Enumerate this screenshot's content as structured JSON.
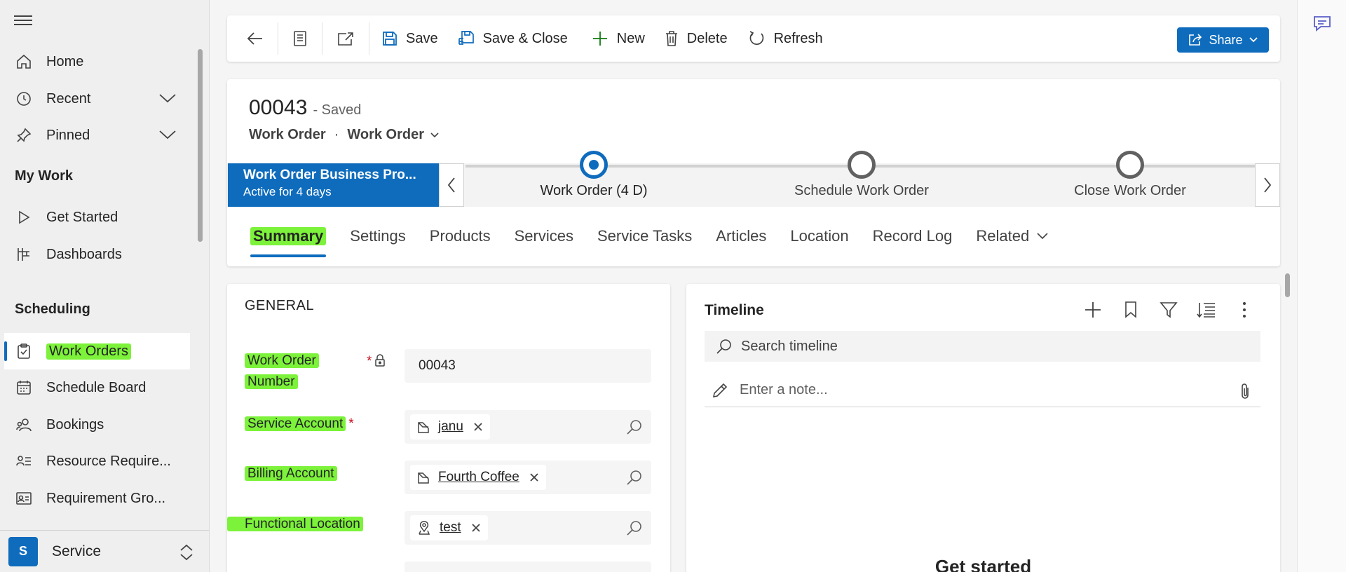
{
  "sidebar": {
    "items_top": [
      {
        "label": "Home",
        "icon": "home-icon"
      },
      {
        "label": "Recent",
        "icon": "clock-icon"
      },
      {
        "label": "Pinned",
        "icon": "pin-icon"
      }
    ],
    "my_work_title": "My Work",
    "my_work": [
      {
        "label": "Get Started",
        "icon": "play-icon"
      },
      {
        "label": "Dashboards",
        "icon": "dashboard-icon"
      }
    ],
    "scheduling_title": "Scheduling",
    "scheduling": [
      {
        "label": "Work Orders",
        "icon": "clipboard-icon"
      },
      {
        "label": "Schedule Board",
        "icon": "calendar-icon"
      },
      {
        "label": "Bookings",
        "icon": "people-icon"
      },
      {
        "label": "Resource Require...",
        "icon": "list-person-icon"
      },
      {
        "label": "Requirement Gro...",
        "icon": "contact-card-icon"
      }
    ],
    "area": {
      "badge": "S",
      "label": "Service"
    }
  },
  "commandbar": {
    "save": "Save",
    "save_close": "Save & Close",
    "new": "New",
    "delete": "Delete",
    "refresh": "Refresh",
    "share": "Share"
  },
  "record": {
    "title": "00043",
    "saved": "- Saved",
    "entity": "Work Order",
    "dot": "·",
    "form": "Work Order"
  },
  "bpf": {
    "name": "Work Order Business Pro...",
    "status": "Active for 4 days",
    "stages": [
      {
        "label": "Work Order  (4 D)",
        "active": true
      },
      {
        "label": "Schedule Work Order",
        "active": false
      },
      {
        "label": "Close Work Order",
        "active": false
      }
    ]
  },
  "tabs": [
    "Summary",
    "Settings",
    "Products",
    "Services",
    "Service Tasks",
    "Articles",
    "Location",
    "Record Log",
    "Related"
  ],
  "general": {
    "title": "GENERAL",
    "wo_number_label_1": "Work Order",
    "wo_number_label_2": "Number",
    "wo_number_value": "00043",
    "service_account_label": "Service Account",
    "service_account_value": "janu",
    "billing_account_label": "Billing Account",
    "billing_account_value": "Fourth Coffee",
    "functional_location_label": "Functional Location",
    "functional_location_value": "test",
    "required_mark": "*"
  },
  "timeline": {
    "title": "Timeline",
    "search_placeholder": "Search timeline",
    "note_placeholder": "Enter a note...",
    "empty_title": "Get started"
  },
  "colors": {
    "accent": "#0f6cbd",
    "highlight": "#7cf23a",
    "required": "#c50f1f"
  }
}
